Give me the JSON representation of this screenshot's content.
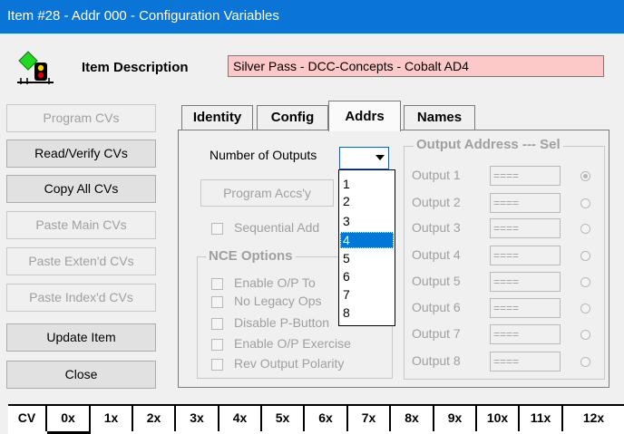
{
  "window": {
    "title": "Item #28 - Addr 000 - Configuration Variables"
  },
  "item": {
    "label": "Item Description",
    "description": "Silver Pass - DCC-Concepts - Cobalt AD4"
  },
  "sidebar": {
    "buttons": [
      {
        "label": "Program CVs",
        "enabled": false
      },
      {
        "label": "Read/Verify CVs",
        "enabled": true
      },
      {
        "label": "Copy All CVs",
        "enabled": true
      },
      {
        "label": "Paste Main CVs",
        "enabled": false
      },
      {
        "label": "Paste Exten'd CVs",
        "enabled": false
      },
      {
        "label": "Paste Index'd CVs",
        "enabled": false
      },
      {
        "label": "Update Item",
        "enabled": true
      },
      {
        "label": "Close",
        "enabled": true
      }
    ]
  },
  "tabs": [
    {
      "label": "Identity"
    },
    {
      "label": "Config"
    },
    {
      "label": "Addrs",
      "selected": true
    },
    {
      "label": "Names"
    }
  ],
  "addrs": {
    "num_outputs_label": "Number of Outputs",
    "num_outputs_value": "",
    "options": [
      "1",
      "2",
      "3",
      "4",
      "5",
      "6",
      "7",
      "8"
    ],
    "highlighted_option": "4",
    "program_accs_label": "Program Accs'y",
    "sequential_label": "Sequential Add",
    "nce_title": "NCE Options",
    "nce_options": [
      "Enable O/P To",
      "No Legacy Ops",
      "Disable P-Button",
      "Enable O/P Exercise",
      "Rev Output Polarity"
    ],
    "output_title": "Output Address --- Sel",
    "outputs": [
      {
        "label": "Output 1",
        "value": "====",
        "selected": true
      },
      {
        "label": "Output 2",
        "value": "====",
        "selected": false
      },
      {
        "label": "Output 3",
        "value": "====",
        "selected": false
      },
      {
        "label": "Output 4",
        "value": "====",
        "selected": false
      },
      {
        "label": "Output 5",
        "value": "====",
        "selected": false
      },
      {
        "label": "Output 6",
        "value": "====",
        "selected": false
      },
      {
        "label": "Output 7",
        "value": "====",
        "selected": false
      },
      {
        "label": "Output 8",
        "value": "====",
        "selected": false
      }
    ]
  },
  "cv_grid": {
    "headers": [
      "CV",
      "0x",
      "1x",
      "2x",
      "3x",
      "4x",
      "5x",
      "6x",
      "7x",
      "8x",
      "9x",
      "10x",
      "11x",
      "12x"
    ]
  }
}
